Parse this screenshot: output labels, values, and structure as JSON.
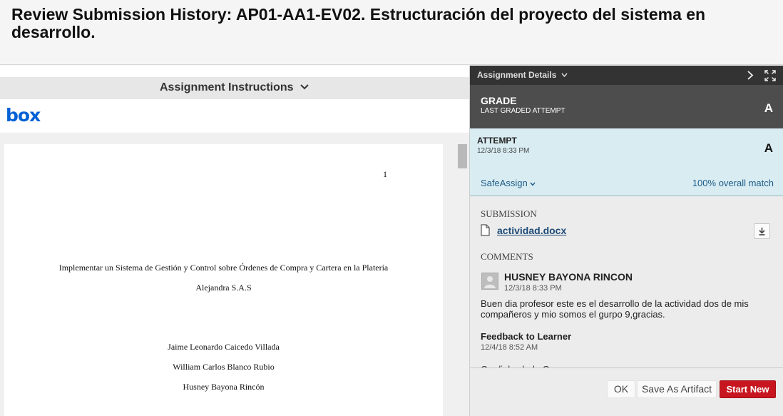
{
  "page": {
    "title": "Review Submission History: AP01-AA1-EV02. Estructuración del proyecto del sistema en desarrollo."
  },
  "instructions": {
    "label": "Assignment Instructions",
    "viewer_brand": "box"
  },
  "document": {
    "page_number": "1",
    "lines": [
      "Implementar un Sistema de Gestión y Control sobre Órdenes de Compra y Cartera en la Platería",
      "Alejandra S.A.S",
      "Jaime Leonardo Caicedo Villada",
      "William Carlos Blanco Rubio",
      "Husney Bayona Rincón"
    ]
  },
  "details": {
    "title": "Assignment Details",
    "icons": [
      "chevron-right-icon",
      "expand-icon"
    ]
  },
  "grade": {
    "label": "GRADE",
    "sublabel": "LAST GRADED ATTEMPT",
    "value": "A"
  },
  "attempt": {
    "label": "ATTEMPT",
    "date": "12/3/18 8:33 PM",
    "value": "A",
    "safeassign_label": "SafeAssign",
    "match_text": "100% overall match"
  },
  "submission": {
    "label": "SUBMISSION",
    "file_name": "actividad.docx"
  },
  "comments": {
    "label": "COMMENTS",
    "author": "HUSNEY BAYONA RINCON",
    "date": "12/3/18 8:33 PM",
    "text": "Buen dia profesor este es el desarrollo de la actividad dos de mis compañeros y mio somos el gurpo 9,gracias.",
    "feedback_title": "Feedback to Learner",
    "feedback_date": "12/4/18 8:52 AM",
    "feedback_text": "Cordial saludo Grupo"
  },
  "footer": {
    "ok_label": "OK",
    "artifact_label": "Save As Artifact",
    "start_label": "Start New"
  },
  "colors": {
    "accent_red": "#c7161f",
    "link_blue": "#1d5d88",
    "grade_bg": "#4d4d4d",
    "attempt_bg": "#d9ecf2"
  }
}
